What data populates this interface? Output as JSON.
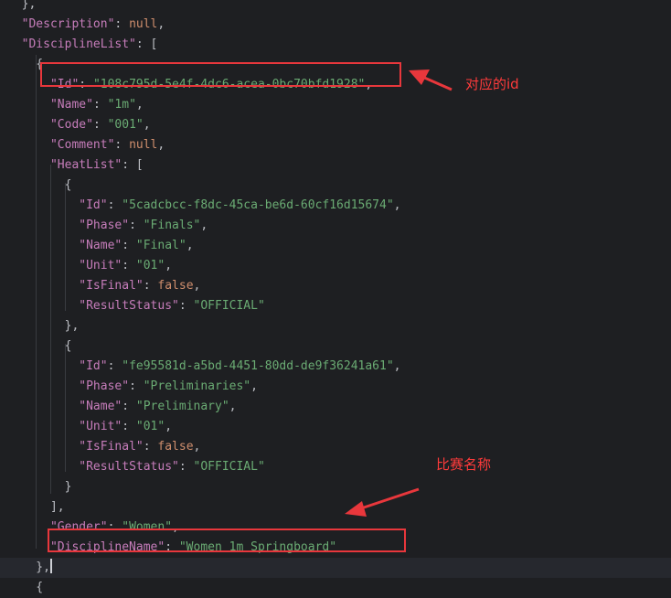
{
  "code_lines": [
    {
      "indent": 0,
      "tokens": [
        {
          "t": "p",
          "v": "  },"
        }
      ]
    },
    {
      "indent": 0,
      "tokens": [
        {
          "t": "p",
          "v": "  "
        },
        {
          "t": "k",
          "v": "\"Description\""
        },
        {
          "t": "p",
          "v": ": "
        },
        {
          "t": "n",
          "v": "null"
        },
        {
          "t": "p",
          "v": ","
        }
      ]
    },
    {
      "indent": 0,
      "tokens": [
        {
          "t": "p",
          "v": "  "
        },
        {
          "t": "k",
          "v": "\"DisciplineList\""
        },
        {
          "t": "p",
          "v": ": ["
        }
      ]
    },
    {
      "indent": 0,
      "tokens": [
        {
          "t": "p",
          "v": "    {"
        }
      ]
    },
    {
      "indent": 0,
      "tokens": [
        {
          "t": "p",
          "v": "      "
        },
        {
          "t": "k",
          "v": "\"Id\""
        },
        {
          "t": "p",
          "v": ": "
        },
        {
          "t": "s",
          "v": "\"108c795d-5e4f-4dc6-acea-0bc70bfd1928\""
        },
        {
          "t": "p",
          "v": ","
        }
      ]
    },
    {
      "indent": 0,
      "tokens": [
        {
          "t": "p",
          "v": "      "
        },
        {
          "t": "k",
          "v": "\"Name\""
        },
        {
          "t": "p",
          "v": ": "
        },
        {
          "t": "s",
          "v": "\"1m\""
        },
        {
          "t": "p",
          "v": ","
        }
      ]
    },
    {
      "indent": 0,
      "tokens": [
        {
          "t": "p",
          "v": "      "
        },
        {
          "t": "k",
          "v": "\"Code\""
        },
        {
          "t": "p",
          "v": ": "
        },
        {
          "t": "s",
          "v": "\"001\""
        },
        {
          "t": "p",
          "v": ","
        }
      ]
    },
    {
      "indent": 0,
      "tokens": [
        {
          "t": "p",
          "v": "      "
        },
        {
          "t": "k",
          "v": "\"Comment\""
        },
        {
          "t": "p",
          "v": ": "
        },
        {
          "t": "n",
          "v": "null"
        },
        {
          "t": "p",
          "v": ","
        }
      ]
    },
    {
      "indent": 0,
      "tokens": [
        {
          "t": "p",
          "v": "      "
        },
        {
          "t": "k",
          "v": "\"HeatList\""
        },
        {
          "t": "p",
          "v": ": ["
        }
      ]
    },
    {
      "indent": 0,
      "tokens": [
        {
          "t": "p",
          "v": "        {"
        }
      ]
    },
    {
      "indent": 0,
      "tokens": [
        {
          "t": "p",
          "v": "          "
        },
        {
          "t": "k",
          "v": "\"Id\""
        },
        {
          "t": "p",
          "v": ": "
        },
        {
          "t": "s",
          "v": "\"5cadcbcc-f8dc-45ca-be6d-60cf16d15674\""
        },
        {
          "t": "p",
          "v": ","
        }
      ]
    },
    {
      "indent": 0,
      "tokens": [
        {
          "t": "p",
          "v": "          "
        },
        {
          "t": "k",
          "v": "\"Phase\""
        },
        {
          "t": "p",
          "v": ": "
        },
        {
          "t": "s",
          "v": "\"Finals\""
        },
        {
          "t": "p",
          "v": ","
        }
      ]
    },
    {
      "indent": 0,
      "tokens": [
        {
          "t": "p",
          "v": "          "
        },
        {
          "t": "k",
          "v": "\"Name\""
        },
        {
          "t": "p",
          "v": ": "
        },
        {
          "t": "s",
          "v": "\"Final\""
        },
        {
          "t": "p",
          "v": ","
        }
      ]
    },
    {
      "indent": 0,
      "tokens": [
        {
          "t": "p",
          "v": "          "
        },
        {
          "t": "k",
          "v": "\"Unit\""
        },
        {
          "t": "p",
          "v": ": "
        },
        {
          "t": "s",
          "v": "\"01\""
        },
        {
          "t": "p",
          "v": ","
        }
      ]
    },
    {
      "indent": 0,
      "tokens": [
        {
          "t": "p",
          "v": "          "
        },
        {
          "t": "k",
          "v": "\"IsFinal\""
        },
        {
          "t": "p",
          "v": ": "
        },
        {
          "t": "n",
          "v": "false"
        },
        {
          "t": "p",
          "v": ","
        }
      ]
    },
    {
      "indent": 0,
      "tokens": [
        {
          "t": "p",
          "v": "          "
        },
        {
          "t": "k",
          "v": "\"ResultStatus\""
        },
        {
          "t": "p",
          "v": ": "
        },
        {
          "t": "s",
          "v": "\"OFFICIAL\""
        }
      ]
    },
    {
      "indent": 0,
      "tokens": [
        {
          "t": "p",
          "v": "        },"
        }
      ]
    },
    {
      "indent": 0,
      "tokens": [
        {
          "t": "p",
          "v": "        {"
        }
      ]
    },
    {
      "indent": 0,
      "tokens": [
        {
          "t": "p",
          "v": "          "
        },
        {
          "t": "k",
          "v": "\"Id\""
        },
        {
          "t": "p",
          "v": ": "
        },
        {
          "t": "s",
          "v": "\"fe95581d-a5bd-4451-80dd-de9f36241a61\""
        },
        {
          "t": "p",
          "v": ","
        }
      ]
    },
    {
      "indent": 0,
      "tokens": [
        {
          "t": "p",
          "v": "          "
        },
        {
          "t": "k",
          "v": "\"Phase\""
        },
        {
          "t": "p",
          "v": ": "
        },
        {
          "t": "s",
          "v": "\"Preliminaries\""
        },
        {
          "t": "p",
          "v": ","
        }
      ]
    },
    {
      "indent": 0,
      "tokens": [
        {
          "t": "p",
          "v": "          "
        },
        {
          "t": "k",
          "v": "\"Name\""
        },
        {
          "t": "p",
          "v": ": "
        },
        {
          "t": "s",
          "v": "\"Preliminary\""
        },
        {
          "t": "p",
          "v": ","
        }
      ]
    },
    {
      "indent": 0,
      "tokens": [
        {
          "t": "p",
          "v": "          "
        },
        {
          "t": "k",
          "v": "\"Unit\""
        },
        {
          "t": "p",
          "v": ": "
        },
        {
          "t": "s",
          "v": "\"01\""
        },
        {
          "t": "p",
          "v": ","
        }
      ]
    },
    {
      "indent": 0,
      "tokens": [
        {
          "t": "p",
          "v": "          "
        },
        {
          "t": "k",
          "v": "\"IsFinal\""
        },
        {
          "t": "p",
          "v": ": "
        },
        {
          "t": "n",
          "v": "false"
        },
        {
          "t": "p",
          "v": ","
        }
      ]
    },
    {
      "indent": 0,
      "tokens": [
        {
          "t": "p",
          "v": "          "
        },
        {
          "t": "k",
          "v": "\"ResultStatus\""
        },
        {
          "t": "p",
          "v": ": "
        },
        {
          "t": "s",
          "v": "\"OFFICIAL\""
        }
      ]
    },
    {
      "indent": 0,
      "tokens": [
        {
          "t": "p",
          "v": "        }"
        }
      ]
    },
    {
      "indent": 0,
      "tokens": [
        {
          "t": "p",
          "v": "      ],"
        }
      ]
    },
    {
      "indent": 0,
      "tokens": [
        {
          "t": "p",
          "v": "      "
        },
        {
          "t": "k",
          "v": "\"Gender\""
        },
        {
          "t": "p",
          "v": ": "
        },
        {
          "t": "s",
          "v": "\"Women\""
        },
        {
          "t": "p",
          "v": ","
        }
      ]
    },
    {
      "indent": 0,
      "tokens": [
        {
          "t": "p",
          "v": "      "
        },
        {
          "t": "k",
          "v": "\"DisciplineName\""
        },
        {
          "t": "p",
          "v": ": "
        },
        {
          "t": "s",
          "v": "\"Women 1m Springboard\""
        }
      ]
    },
    {
      "indent": 0,
      "tokens": [
        {
          "t": "p",
          "v": "    },"
        }
      ],
      "caret": true
    },
    {
      "indent": 0,
      "tokens": [
        {
          "t": "p",
          "v": "    {"
        }
      ]
    }
  ],
  "annotations": {
    "id_label": "对应的id",
    "name_label": "比赛名称"
  },
  "colors": {
    "background": "#1e1f22",
    "key": "#c77dbb",
    "string": "#6aab73",
    "keyword": "#cf8e6d",
    "punctuation": "#bcbec4",
    "annotation": "#e8373c"
  }
}
